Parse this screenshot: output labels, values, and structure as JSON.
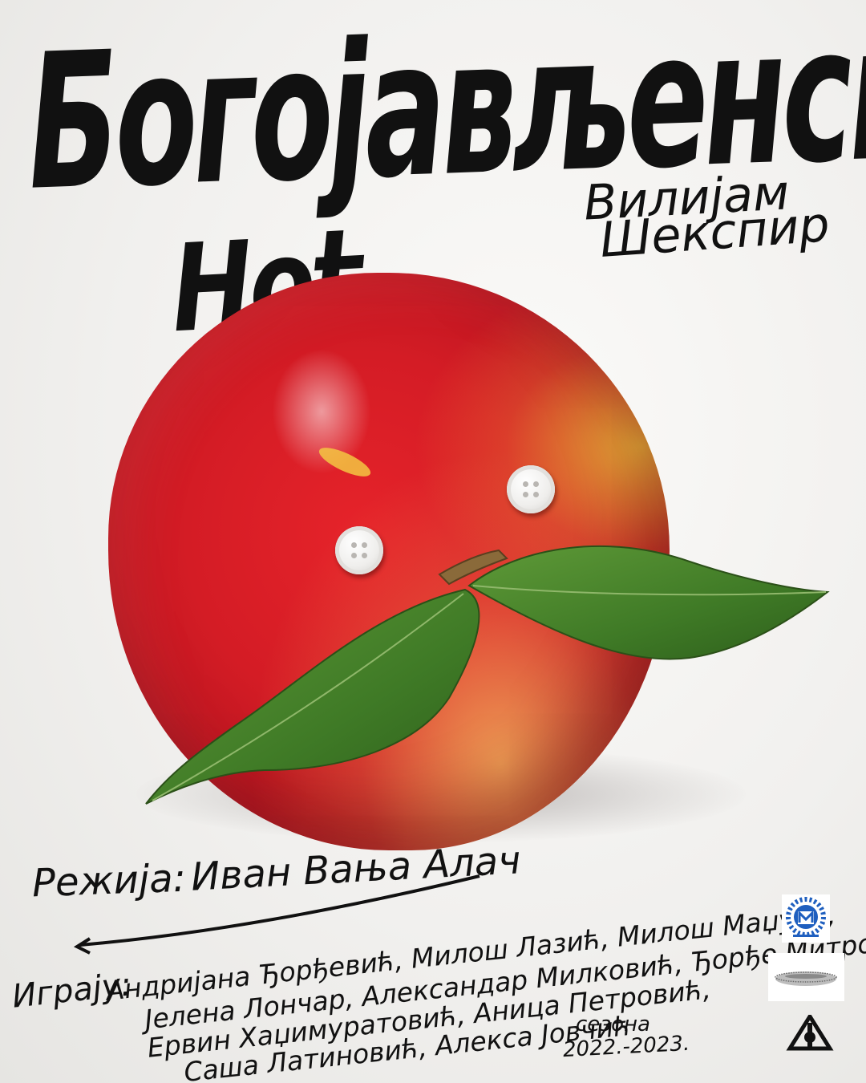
{
  "title": {
    "line1": "Богојављенска",
    "line2": "Ноћ"
  },
  "author": {
    "first": "Вилијам",
    "last": "Шекспир"
  },
  "director": {
    "label": "Режија:",
    "name": "Иван Вања Алач"
  },
  "cast": {
    "label": "Играју:",
    "lines": [
      "Андријана Ђорђевић, Милош Лазић, Милош Маџура,",
      "Јелена Лончар, Александар Милковић, Ђорђе Митровић,",
      "Ервин Хаџимуратовић, Аница Петровић,",
      "Саша Латиновић, Алекса Јовчић"
    ]
  },
  "season": {
    "label": "сезона",
    "years": "2022.-2023."
  },
  "logos": [
    "theatre-logo-icon",
    "arena-logo-icon",
    "studio-mark-icon"
  ],
  "colors": {
    "apple_red": "#d41c25",
    "leaf_green": "#4f8a2e",
    "ink": "#111111",
    "logo_blue": "#1f5fbf"
  }
}
